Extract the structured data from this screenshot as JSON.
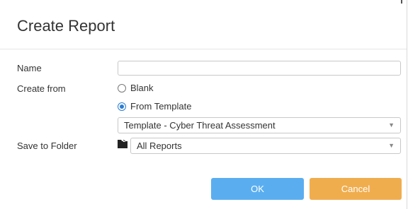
{
  "dialog": {
    "title": "Create Report"
  },
  "form": {
    "name_label": "Name",
    "name_value": "",
    "create_from_label": "Create from",
    "option_blank": "Blank",
    "option_template": "From Template",
    "selected_option": "From Template",
    "template_value": "Template - Cyber Threat Assessment",
    "save_folder_label": "Save to Folder",
    "folder_value": "All Reports"
  },
  "buttons": {
    "ok": "OK",
    "cancel": "Cancel"
  },
  "icons": {
    "folder": "folder-icon",
    "dropdown": "chevron-down-icon"
  },
  "colors": {
    "ok_button": "#5aaef0",
    "cancel_button": "#f0ad4e",
    "radio_accent": "#2b7cd3"
  }
}
